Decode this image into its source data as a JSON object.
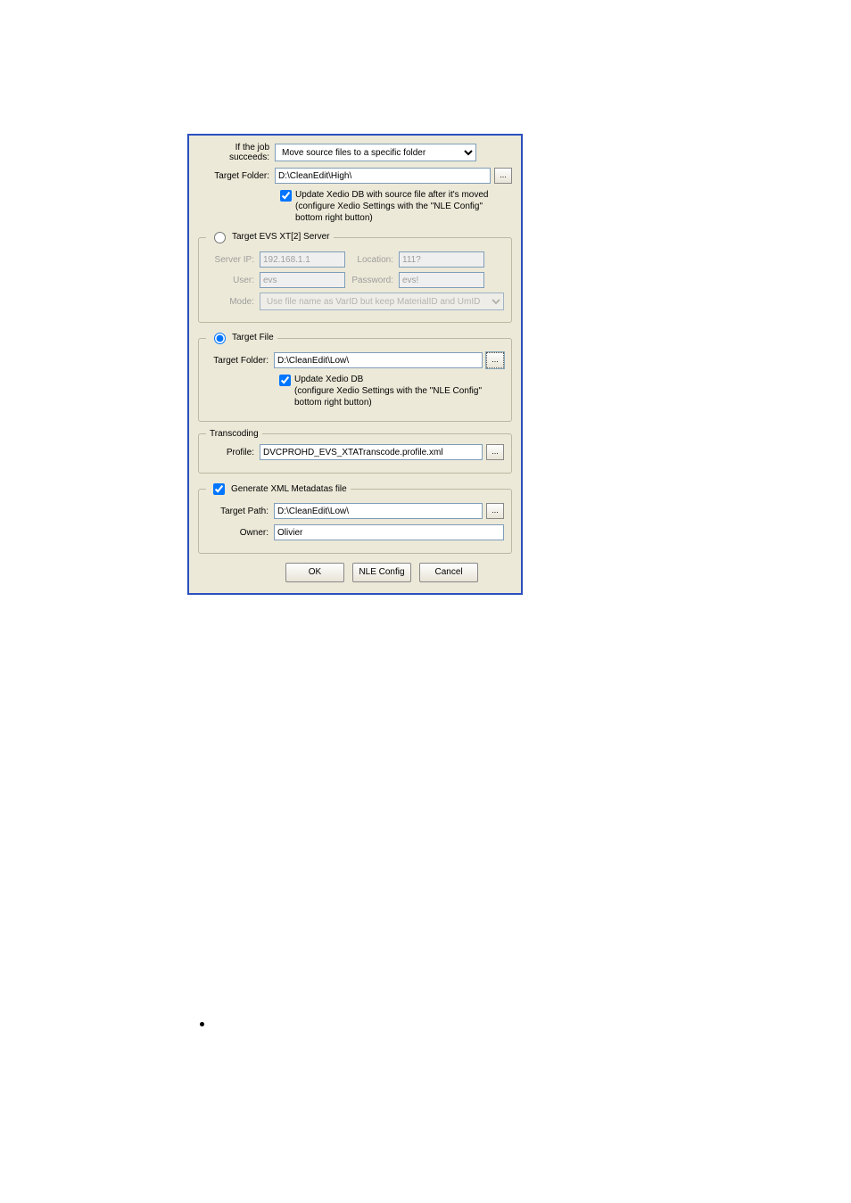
{
  "top": {
    "if_succeeds_label": "If the job succeeds:",
    "if_succeeds_value": "Move source files to a specific folder",
    "target_folder_label": "Target Folder:",
    "target_folder_value": "D:\\CleanEdit\\High\\",
    "chk_update_label": "Update Xedio DB with source file after it's moved",
    "chk_hint": "(configure Xedio Settings with the \"NLE Config\" bottom right button)"
  },
  "xt": {
    "legend": "Target EVS XT[2] Server",
    "server_ip_label": "Server IP:",
    "server_ip_value": "192.168.1.1",
    "location_label": "Location:",
    "location_value": "111?",
    "user_label": "User:",
    "user_value": "evs",
    "password_label": "Password:",
    "password_value": "evs!",
    "mode_label": "Mode:",
    "mode_value": "Use file name as VarID but keep MaterialID and UmID"
  },
  "tgtfile": {
    "legend": "Target File",
    "target_folder_label": "Target Folder:",
    "target_folder_value": "D:\\CleanEdit\\Low\\",
    "chk_update_label": "Update Xedio DB",
    "chk_hint": "(configure Xedio Settings with the \"NLE Config\" bottom right button)"
  },
  "transcoding": {
    "legend": "Transcoding",
    "profile_label": "Profile:",
    "profile_value": "DVCPROHD_EVS_XTATranscode.profile.xml"
  },
  "meta": {
    "chk_label": "Generate XML Metadatas file",
    "target_path_label": "Target Path:",
    "target_path_value": "D:\\CleanEdit\\Low\\",
    "owner_label": "Owner:",
    "owner_value": "Olivier"
  },
  "buttons": {
    "ok": "OK",
    "nle": "NLE Config",
    "cancel": "Cancel"
  }
}
